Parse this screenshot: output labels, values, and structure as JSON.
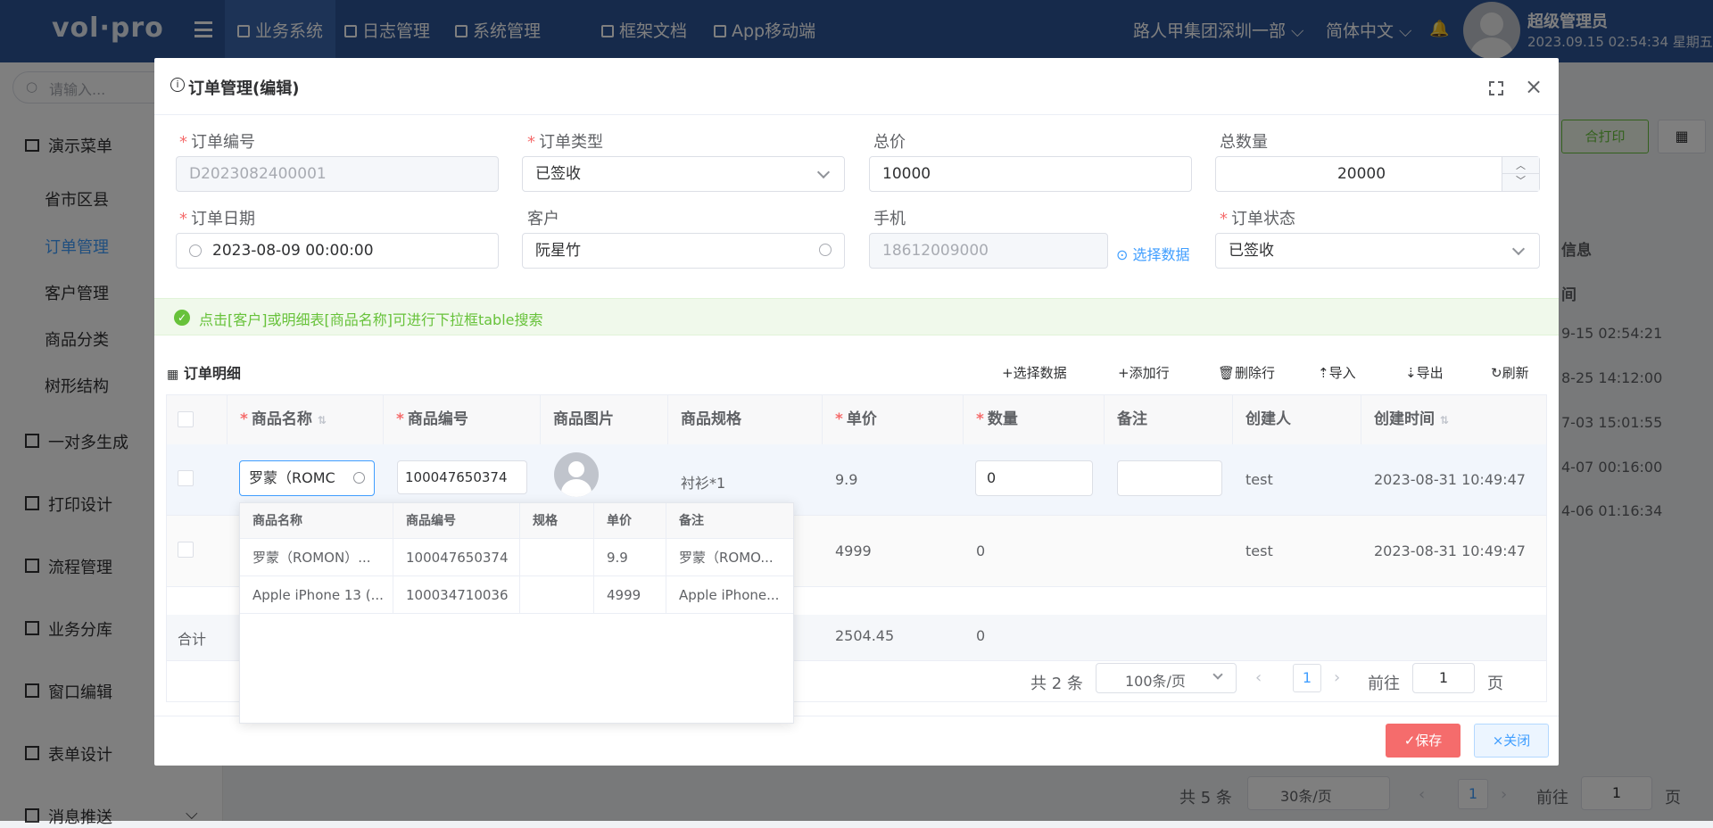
{
  "topbar": {
    "logo": "vol·pro",
    "nav": [
      {
        "label": "业务系统",
        "icon": "monitor-icon"
      },
      {
        "label": "日志管理",
        "icon": "calendar-icon"
      },
      {
        "label": "系统管理",
        "icon": "monitor-icon"
      },
      {
        "label": "框架文档",
        "icon": "document-icon"
      },
      {
        "label": "App移动端",
        "icon": "phone-icon"
      }
    ],
    "org": "路人甲集团深圳一部",
    "lang": "简体中文",
    "user_name": "超级管理员",
    "datetime": "2023.09.15 02:54:34 星期五"
  },
  "sidebar": {
    "search_placeholder": "请输入...",
    "items": [
      {
        "label": "演示菜单",
        "icon": "monitor-icon"
      },
      {
        "label": "省市区县"
      },
      {
        "label": "订单管理",
        "active": true
      },
      {
        "label": "客户管理"
      },
      {
        "label": "商品分类"
      },
      {
        "label": "树形结构"
      },
      {
        "label": "一对多生成",
        "icon": "calendar-icon"
      },
      {
        "label": "打印设计",
        "icon": "printer-icon"
      },
      {
        "label": "流程管理",
        "icon": "document-icon"
      },
      {
        "label": "业务分库",
        "icon": "folder-icon"
      },
      {
        "label": "窗口编辑",
        "icon": "monitor-icon"
      },
      {
        "label": "表单设计",
        "icon": "form-icon"
      },
      {
        "label": "消息推送",
        "icon": "message-icon"
      }
    ]
  },
  "background": {
    "print_btn": "合打印",
    "col_header_a": "信息",
    "col_header_b": "间",
    "times": [
      "9-15 02:54:21",
      "8-25 14:12:00",
      "7-03 15:01:55",
      "4-07 00:16:00",
      "4-06 01:16:34"
    ],
    "total": "共 5 条",
    "page_size": "30条/页",
    "page": "1",
    "goto_label": "前往",
    "goto_value": "1",
    "page_unit": "页"
  },
  "dialog": {
    "title": "订单管理(编辑)",
    "fields": {
      "order_no_label": "订单编号",
      "order_no_value": "D2023082400001",
      "order_type_label": "订单类型",
      "order_type_value": "已签收",
      "total_price_label": "总价",
      "total_price_value": "10000",
      "total_qty_label": "总数量",
      "total_qty_value": "20000",
      "order_date_label": "订单日期",
      "order_date_value": "2023-08-09 00:00:00",
      "customer_label": "客户",
      "customer_value": "阮星竹",
      "phone_label": "手机",
      "phone_value": "18612009000",
      "select_data_link": "选择数据",
      "order_status_label": "订单状态",
      "order_status_value": "已签收"
    },
    "tip": "点击[客户]或明细表[商品名称]可进行下拉框table搜索",
    "detail_title": "订单明细",
    "toolbar": [
      "+选择数据",
      "+添加行",
      "删除行",
      "导入",
      "导出",
      "刷新"
    ],
    "columns": [
      "商品名称",
      "商品编号",
      "商品图片",
      "商品规格",
      "单价",
      "数量",
      "备注",
      "创建人",
      "创建时间"
    ],
    "rows": [
      {
        "name": "罗蒙（ROMC",
        "code": "100047650374",
        "spec": "衬衫*1",
        "price": "9.9",
        "qty": "0",
        "remark": "",
        "creator": "test",
        "created": "2023-08-31 10:49:47"
      },
      {
        "name": "",
        "code": "",
        "spec": "",
        "price": "4999",
        "qty": "0",
        "remark": "",
        "creator": "test",
        "created": "2023-08-31 10:49:47"
      }
    ],
    "summary_label": "合计",
    "summary_price": "2504.45",
    "summary_qty": "0",
    "pager": {
      "total": "共 2 条",
      "page_size": "100条/页",
      "page": "1",
      "goto_label": "前往",
      "goto_value": "1",
      "page_unit": "页"
    },
    "dropdown": {
      "columns": [
        "商品名称",
        "商品编号",
        "规格",
        "单价",
        "备注"
      ],
      "rows": [
        [
          "罗蒙（ROMON）...",
          "100047650374",
          "",
          "9.9",
          "罗蒙（ROMO..."
        ],
        [
          "Apple iPhone 13 (...",
          "100034710036",
          "",
          "4999",
          "Apple iPhone..."
        ]
      ]
    },
    "save_btn": "✓保存",
    "close_btn": "×关闭"
  },
  "colors": {
    "topbar": "#2c5597",
    "primary": "#409eff",
    "danger": "#f56c6c",
    "success": "#67c23a"
  }
}
